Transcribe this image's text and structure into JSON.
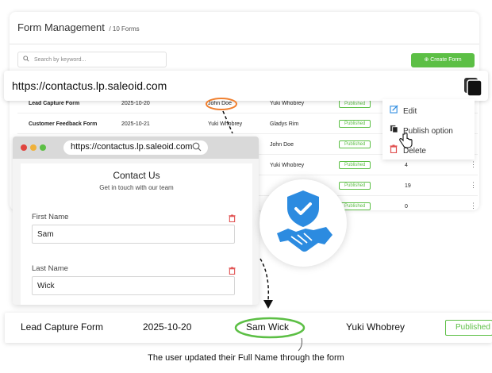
{
  "management": {
    "title": "Form Management",
    "subtitle": "/ 10 Forms",
    "search_placeholder": "Search by keyword...",
    "create_button": "Create Form",
    "rows": [
      {
        "name": "Lead Capture Form",
        "date": "2025-10-20",
        "updated_by": "John Doe",
        "owner": "Yuki Whobrey",
        "status": "Published",
        "count": ""
      },
      {
        "name": "Customer Feedback Form",
        "date": "2025-10-21",
        "updated_by": "Yuki Whobrey",
        "owner": "Gladys Rim",
        "status": "Published",
        "count": ""
      },
      {
        "name": "",
        "date": "",
        "updated_by": "",
        "owner": "John Doe",
        "status": "Published",
        "count": ""
      },
      {
        "name": "",
        "date": "",
        "updated_by": "",
        "owner": "Yuki Whobrey",
        "status": "Published",
        "count": "4"
      },
      {
        "name": "",
        "date": "",
        "updated_by": "",
        "owner": "",
        "status": "Published",
        "count": "19"
      },
      {
        "name": "",
        "date": "",
        "updated_by": "",
        "owner": "",
        "status": "Published",
        "count": "0"
      }
    ]
  },
  "url_bar": {
    "url": "https://contactus.lp.saleoid.com"
  },
  "context_menu": {
    "items": [
      {
        "label": "Edit",
        "icon": "edit-icon"
      },
      {
        "label": "Publish option",
        "icon": "publish-icon"
      },
      {
        "label": "Delete",
        "icon": "trash-icon"
      }
    ]
  },
  "browser": {
    "url": "https://contactus.lp.saleoid.com",
    "form": {
      "title": "Contact Us",
      "subtitle": "Get in touch with our team",
      "fields": [
        {
          "label": "First Name",
          "value": "Sam"
        },
        {
          "label": "Last Name",
          "value": "Wick"
        }
      ]
    }
  },
  "result_row": {
    "name": "Lead Capture Form",
    "date": "2025-10-20",
    "updated_by": "Sam Wick",
    "owner": "Yuki Whobrey",
    "status": "Published"
  },
  "caption": "The user updated their Full Name through the form",
  "colors": {
    "accent_green": "#5cbf45",
    "shield_blue": "#2c8be0",
    "highlight_orange": "#f08030",
    "highlight_green": "#5cbf45",
    "delete_red": "#e05050"
  }
}
